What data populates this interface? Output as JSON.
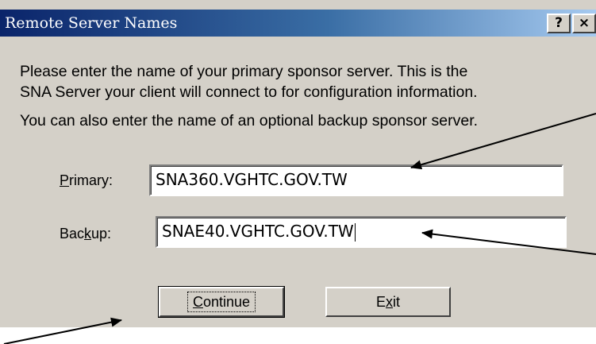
{
  "window": {
    "title": "Remote Server Names",
    "help_glyph": "?",
    "close_glyph": "×"
  },
  "intro": {
    "line1": "Please enter the name of your primary sponsor server.  This is the",
    "line2": "SNA Server your client will connect to for configuration information.",
    "line3": "You can also enter the name of an optional backup sponsor server."
  },
  "fields": {
    "primary": {
      "label_mnemonic": "P",
      "label_rest": "rimary:",
      "value": "SNA360.VGHTC.GOV.TW"
    },
    "backup": {
      "label_pre": "Bac",
      "label_mnemonic": "k",
      "label_post": "up:",
      "value": "SNAE40.VGHTC.GOV.TW"
    }
  },
  "buttons": {
    "continue_mnemonic": "C",
    "continue_rest": "ontinue",
    "exit_pre": "E",
    "exit_mnemonic": "x",
    "exit_post": "it"
  },
  "colors": {
    "dialog_face": "#d4d0c8",
    "titlebar_start": "#0a246a",
    "titlebar_end": "#a6caf0"
  }
}
